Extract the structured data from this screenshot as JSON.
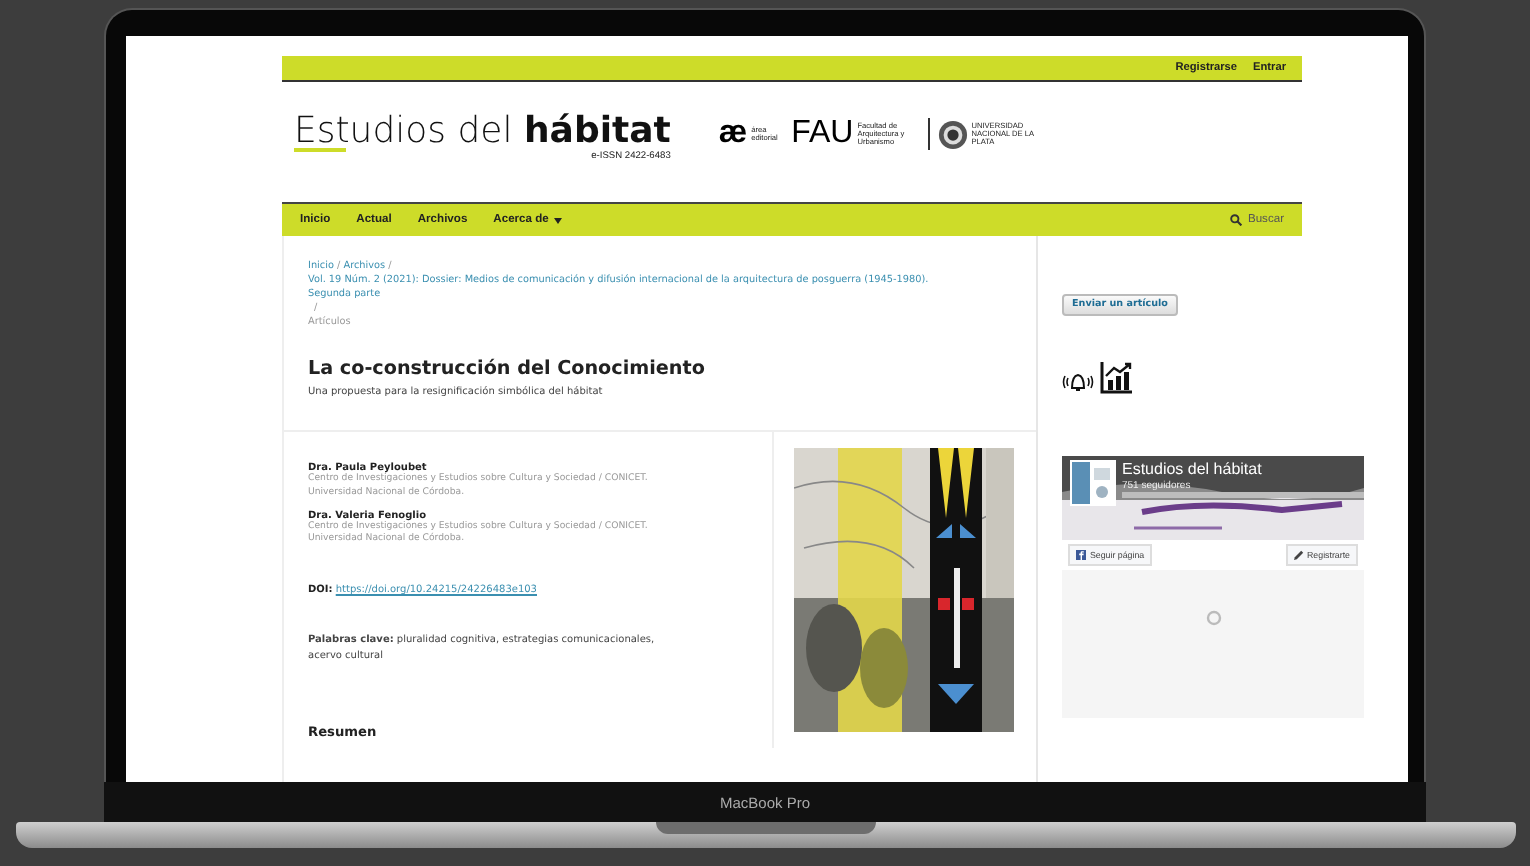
{
  "device": {
    "label": "MacBook Pro"
  },
  "top_bar": {
    "links": [
      "Registrarse",
      "Entrar"
    ]
  },
  "header": {
    "title_light": "Estudios del",
    "title_bold": "hábitat",
    "issn": "e-ISSN 2422-6483",
    "partners": [
      {
        "kind": "mark",
        "symbol": "æ",
        "text": "área editorial"
      },
      {
        "kind": "wordmark",
        "symbol": "FAU",
        "text": "Facultad de Arquitectura y Urbanismo"
      },
      {
        "kind": "seal",
        "text": "UNIVERSIDAD NACIONAL DE LA PLATA"
      }
    ]
  },
  "nav": {
    "items": [
      {
        "label": "Inicio",
        "dropdown": false
      },
      {
        "label": "Actual",
        "dropdown": false
      },
      {
        "label": "Archivos",
        "dropdown": false
      },
      {
        "label": "Acerca de",
        "dropdown": true
      }
    ],
    "search": "Buscar"
  },
  "breadcrumb": {
    "separator": "/",
    "items": [
      {
        "label": "Inicio",
        "current": false
      },
      {
        "label": "Archivos",
        "current": false
      },
      {
        "label": "Vol. 19 Núm. 2 (2021): Dossier: Medios de comunicación y difusión internacional de la arquitectura de posguerra (1945-1980). Segunda parte",
        "current": false
      },
      {
        "label": "Artículos",
        "current": true
      }
    ]
  },
  "article": {
    "title": "La co-construcción del Conocimiento",
    "subtitle": "Una propuesta para la resignificación simbólica del hábitat",
    "authors": [
      {
        "name": "Dra. Paula Peyloubet",
        "affiliation": "Centro de Investigaciones y Estudios sobre Cultura y Sociedad / CONICET. Universidad Nacional de Córdoba."
      },
      {
        "name": "Dra. Valeria Fenoglio",
        "affiliation": "Centro de Investigaciones y Estudios sobre Cultura y Sociedad / CONICET. Universidad Nacional de Córdoba."
      }
    ],
    "doi_label": "DOI:",
    "doi": "https://doi.org/10.24215/24226483e103",
    "keywords_label": "Palabras clave:",
    "keywords": "pluralidad cognitiva, estrategias comunicacionales, acervo cultural",
    "abstract_heading": "Resumen"
  },
  "sidebar": {
    "submit_button": "Enviar un artículo",
    "facebook": {
      "page_name": "Estudios del hábitat",
      "followers": "751 seguidores",
      "follow": "Seguir página",
      "register": "Registrarte"
    }
  }
}
